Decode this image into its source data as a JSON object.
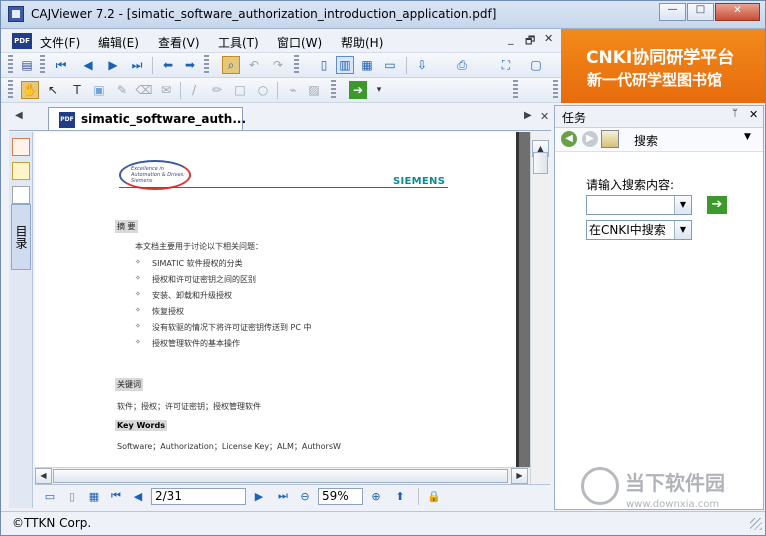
{
  "window": {
    "title": "CAJViewer 7.2 - [simatic_software_authorization_introduction_application.pdf]",
    "controls": {
      "minimize": "—",
      "maximize": "□",
      "close": "✕"
    }
  },
  "menubar": {
    "items": [
      "文件(F)",
      "编辑(E)",
      "查看(V)",
      "工具(T)",
      "窗口(W)",
      "帮助(H)"
    ],
    "doc_controls": {
      "minimize": "_",
      "restore": "🗗",
      "close": "✕"
    }
  },
  "toolbar": {
    "row1": [
      "nav-first-icon",
      "nav-prev-icon",
      "nav-next-icon",
      "nav-last-icon",
      "back-icon",
      "forward-icon",
      "search-doc-icon",
      "undo-icon",
      "redo-icon",
      "single-page-icon",
      "continuous-icon",
      "facing-icon",
      "two-page-icon",
      "export-icon",
      "print-icon",
      "fullscreen-icon",
      "new-icon"
    ],
    "row2": [
      "hand-icon",
      "select-icon",
      "text-select-icon",
      "image-select-icon",
      "highlight-icon",
      "eraser-icon",
      "note-icon",
      "pen-icon",
      "marker-icon",
      "rectangle-icon",
      "ellipse-icon",
      "link-icon",
      "layout-icon",
      "go-icon"
    ]
  },
  "banner": {
    "line1": "CNKI协同研学平台",
    "line2": "新一代研学型图书馆"
  },
  "document_tab": {
    "label": "simatic_software_auth..."
  },
  "left_strip": {
    "label": "目录"
  },
  "page": {
    "logo_lines": [
      "Excellence in",
      "Automation & Drives:",
      "Siemens"
    ],
    "brand": "SIEMENS",
    "summary_heading": "摘 要",
    "intro": "本文档主要用于讨论以下相关问题：",
    "bullet_symbol": "✧",
    "bullets": [
      "SIMATIC 软件授权的分类",
      "授权和许可证密钥之间的区别",
      "安装、卸载和升级授权",
      "恢复授权",
      "没有软驱的情况下将许可证密钥传送到 PC 中",
      "授权管理软件的基本操作"
    ],
    "keywords_heading": "关键词",
    "keywords": "软件；授权；许可证密钥；授权管理软件",
    "keywords_en_heading": "Key Words",
    "keywords_en": "Software；Authorization；License Key；ALM；AuthorsW"
  },
  "status_nav": {
    "page": "2/31",
    "zoom": "59%"
  },
  "task_panel": {
    "title": "任务",
    "pin": "ᛘ",
    "close": "✕",
    "search_tab": "搜索",
    "prompt": "请输入搜索内容:",
    "search_value": "",
    "scope": "在CNKI中搜索",
    "go": "➔"
  },
  "watermark": {
    "title": "当下软件园",
    "url": "www.downxia.com"
  },
  "statusbar": {
    "text": "©TTKN Corp."
  }
}
